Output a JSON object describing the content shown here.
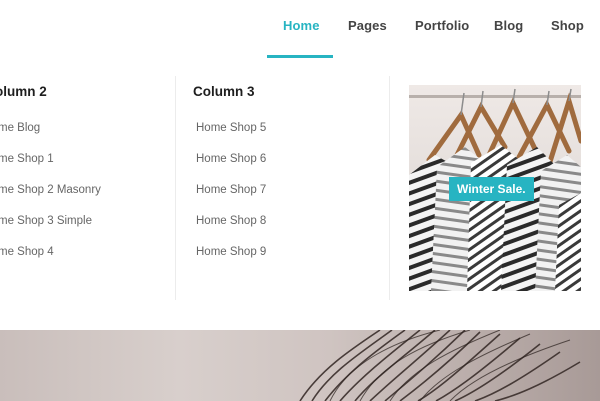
{
  "nav": {
    "items": [
      {
        "label": "Home",
        "active": true
      },
      {
        "label": "Pages"
      },
      {
        "label": "Portfolio"
      },
      {
        "label": "Blog"
      },
      {
        "label": "Shop"
      }
    ]
  },
  "mega_menu": {
    "column2": {
      "title": "olumn 2",
      "links": [
        "me Blog",
        "me Shop 1",
        "me Shop 2 Masonry",
        "me Shop 3 Simple",
        "me Shop 4"
      ]
    },
    "column3": {
      "title": "Column 3",
      "links": [
        "Home Shop 5",
        "Home Shop 6",
        "Home Shop 7",
        "Home Shop 8",
        "Home Shop 9"
      ]
    },
    "promo": {
      "badge": "Winter Sale."
    }
  },
  "colors": {
    "accent": "#27b4c2",
    "text_dark": "#1e1e1e",
    "text_muted": "#666666"
  }
}
